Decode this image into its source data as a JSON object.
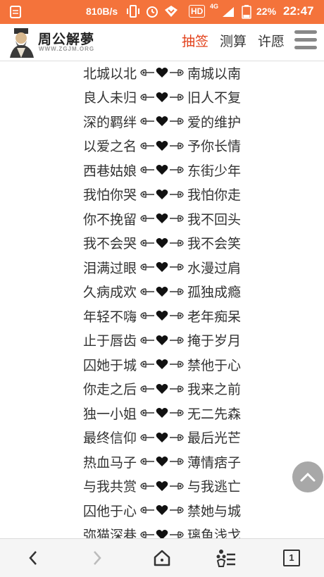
{
  "status_bar": {
    "net_speed": "810B/s",
    "network_label": "HD",
    "network_type": "4G",
    "battery": "22%",
    "time": "22:47",
    "bg_color": "#f4733b"
  },
  "header": {
    "logo_title": "周公解夢",
    "logo_sub": "WWW.ZGJM.ORG",
    "nav": [
      "抽签",
      "测算",
      "许愿"
    ],
    "active_nav": "抽签",
    "accent_color": "#e2401a"
  },
  "rows": [
    {
      "left": "北城以北",
      "right": "南城以南"
    },
    {
      "left": "良人未归",
      "right": "旧人不复"
    },
    {
      "left": "深的羁绊",
      "right": "爱的维护"
    },
    {
      "left": "以爱之名",
      "right": "予你长情"
    },
    {
      "left": "西巷姑娘",
      "right": "东街少年"
    },
    {
      "left": "我怕你哭",
      "right": "我怕你走"
    },
    {
      "left": "你不挽留",
      "right": "我不回头"
    },
    {
      "left": "我不会哭",
      "right": "我不会笑"
    },
    {
      "left": "泪满过眼",
      "right": "水漫过肩"
    },
    {
      "left": "久病成欢",
      "right": "孤独成瘾"
    },
    {
      "left": "年轻不嗨",
      "right": "老年痴呆"
    },
    {
      "left": "止于唇齿",
      "right": "掩于岁月"
    },
    {
      "left": "囚她于城",
      "right": "禁他于心"
    },
    {
      "left": "你走之后",
      "right": "我来之前"
    },
    {
      "left": "独一小姐",
      "right": "无二先森"
    },
    {
      "left": "最终信仰",
      "right": "最后光芒"
    },
    {
      "left": "热血马子",
      "right": "薄情痞子"
    },
    {
      "left": "与我共赏",
      "right": "与我逃亡"
    },
    {
      "left": "囚他于心",
      "right": "禁她与城"
    },
    {
      "left": "弥猫深巷",
      "right": "璃鱼浅戈"
    }
  ],
  "toolbar": {
    "tab_count": "1",
    "icons": [
      "back-icon",
      "forward-icon",
      "home-icon",
      "menu-list-icon",
      "tabs-icon"
    ]
  }
}
